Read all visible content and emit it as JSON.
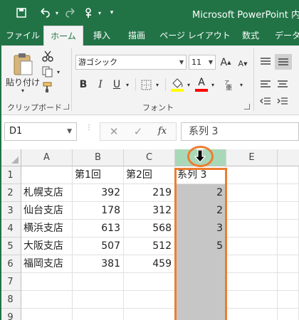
{
  "title_bar": {
    "title": "Microsoft PowerPoint 内の",
    "icons": [
      "save-icon",
      "undo-icon",
      "redo-icon",
      "touch-mode-icon",
      "customize-qat-icon"
    ]
  },
  "tabs": [
    {
      "label": "ファイル"
    },
    {
      "label": "ホーム",
      "active": true
    },
    {
      "label": "挿入"
    },
    {
      "label": "描画"
    },
    {
      "label": "ページ レイアウト"
    },
    {
      "label": "数式"
    },
    {
      "label": "データ"
    }
  ],
  "ribbon": {
    "clipboard": {
      "paste_label": "貼り付け",
      "group_label": "クリップボード"
    },
    "font": {
      "font_name": "游ゴシック",
      "font_size": "11",
      "bold": "B",
      "italic": "I",
      "underline": "U",
      "grow_font": "A",
      "shrink_font": "A",
      "font_color_glyph": "A",
      "group_label": "フォント",
      "accent_colors": {
        "highlight": "#ffff00",
        "font_color": "#ff0000"
      }
    }
  },
  "formula_bar": {
    "name_box": "D1",
    "cancel": "✕",
    "enter": "✓",
    "fx": "fx",
    "value": "系列 3"
  },
  "sheet": {
    "columns": [
      "A",
      "B",
      "C",
      "D",
      "E"
    ],
    "rows": [
      "1",
      "2",
      "3",
      "4",
      "5",
      "6",
      "7",
      "8",
      "9"
    ],
    "cells": [
      [
        "",
        "第1回",
        "第2回",
        "系列 3",
        ""
      ],
      [
        "札幌支店",
        "392",
        "219",
        "2",
        ""
      ],
      [
        "仙台支店",
        "178",
        "312",
        "2",
        ""
      ],
      [
        "横浜支店",
        "613",
        "568",
        "3",
        ""
      ],
      [
        "大阪支店",
        "507",
        "512",
        "5",
        ""
      ],
      [
        "福岡支店",
        "381",
        "459",
        "",
        ""
      ],
      [
        "",
        "",
        "",
        "",
        ""
      ],
      [
        "",
        "",
        "",
        "",
        ""
      ],
      [
        "",
        "",
        "",
        "",
        ""
      ]
    ],
    "selected_column": "D",
    "highlight_color": "#ed7d31",
    "header_accent": "#217346"
  }
}
